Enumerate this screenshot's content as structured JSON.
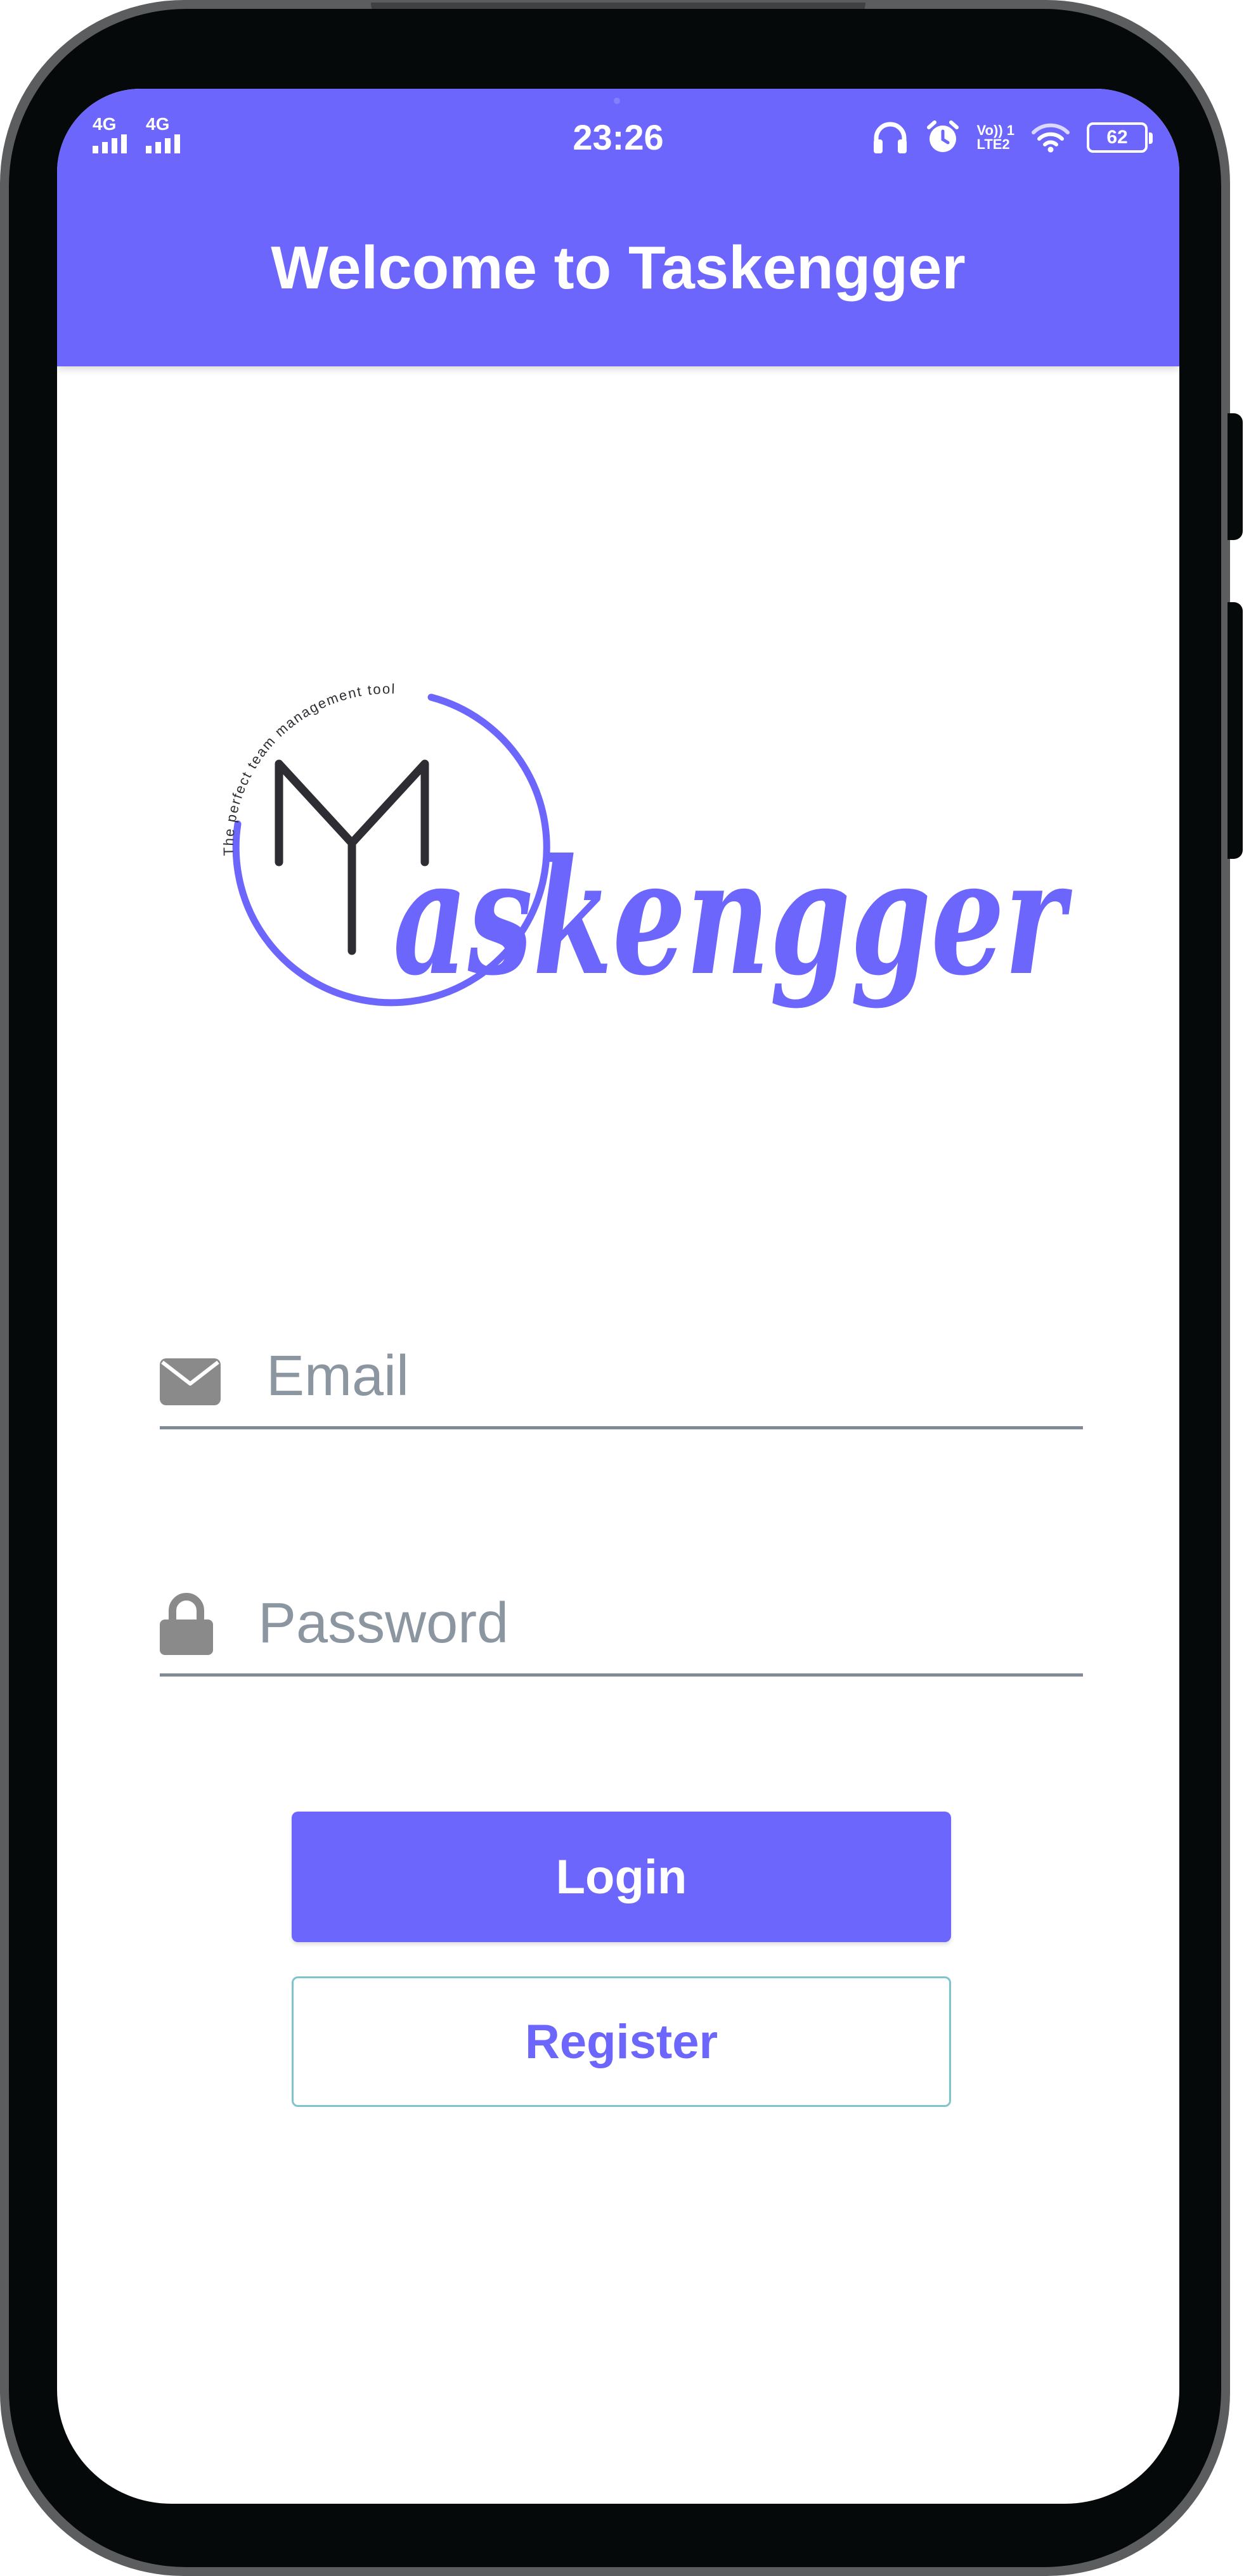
{
  "status_bar": {
    "network_1": "4G",
    "network_2": "4G",
    "time": "23:26",
    "volte_line1": "Vo)) 1",
    "volte_line2": "LTE2",
    "battery": "62",
    "icons": [
      "headphones-icon",
      "alarm-icon",
      "wifi-icon",
      "battery-icon"
    ]
  },
  "app_bar": {
    "title": "Welcome to Taskengger"
  },
  "logo": {
    "brand_name": "askengger",
    "tagline": "The perfect team management tool",
    "colors": {
      "primary": "#6c66fd",
      "mark": "#2e2d33"
    }
  },
  "form": {
    "email": {
      "placeholder": "Email",
      "value": "",
      "icon": "envelope-icon"
    },
    "password": {
      "placeholder": "Password",
      "value": "",
      "icon": "lock-icon"
    }
  },
  "buttons": {
    "login": "Login",
    "register": "Register"
  },
  "theme": {
    "accent": "#6c66fd",
    "register_border": "#7fc4cd",
    "placeholder": "#8c96a1"
  }
}
